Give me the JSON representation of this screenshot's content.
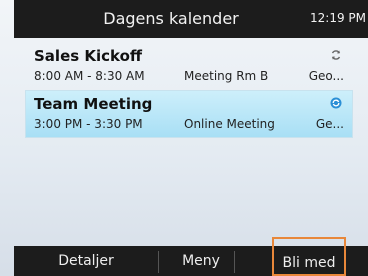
{
  "header": {
    "title": "Dagens kalender",
    "clock": "12:19 PM"
  },
  "meetings": [
    {
      "subject": "Sales Kickoff",
      "time": "8:00 AM - 8:30 AM",
      "location": "Meeting Rm B",
      "more": "Geo...",
      "icon": "sync-icon",
      "selected": false
    },
    {
      "subject": "Team Meeting",
      "time": "3:00 PM - 3:30 PM",
      "location": "Online Meeting",
      "more": "Ge...",
      "icon": "online-meeting-icon",
      "selected": true
    }
  ],
  "softkeys": {
    "details": "Detaljer",
    "menu": "Meny",
    "join": "Bli med"
  },
  "colors": {
    "selection": "#a8dff5",
    "highlight_border": "#e8873a",
    "bar": "#1c1c1c"
  }
}
